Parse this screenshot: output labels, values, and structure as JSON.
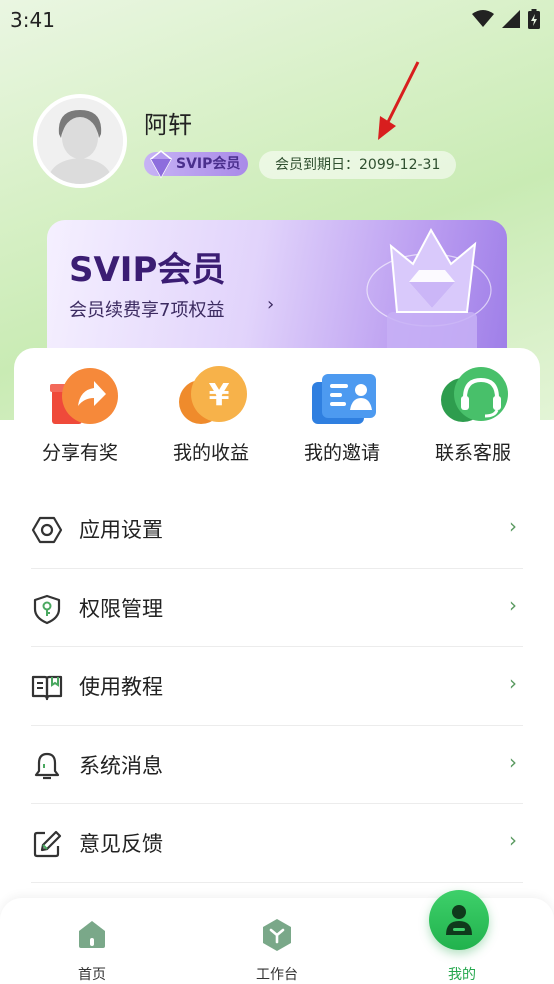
{
  "status_bar": {
    "time": "3:41",
    "icons": [
      "wifi-icon",
      "signal-icon",
      "battery-icon"
    ]
  },
  "profile": {
    "username": "阿轩",
    "badge_label": "SVIP会员",
    "expiry_label": "会员到期日：",
    "expiry_date": "2099-12-31"
  },
  "vip_card": {
    "title": "SVIP会员",
    "subtitle": "会员续费享7项权益",
    "arrow": "›"
  },
  "quick_actions": [
    {
      "label": "分享有奖",
      "icon": "gift-share-icon"
    },
    {
      "label": "我的收益",
      "icon": "yuan-coin-icon"
    },
    {
      "label": "我的邀请",
      "icon": "contact-card-icon"
    },
    {
      "label": "联系客服",
      "icon": "headset-icon"
    }
  ],
  "menu": [
    {
      "label": "应用设置",
      "icon": "hexagon-settings-icon"
    },
    {
      "label": "权限管理",
      "icon": "shield-key-icon"
    },
    {
      "label": "使用教程",
      "icon": "book-icon"
    },
    {
      "label": "系统消息",
      "icon": "bell-icon"
    },
    {
      "label": "意见反馈",
      "icon": "edit-icon"
    }
  ],
  "menu_chevron": "›",
  "bottom_nav": [
    {
      "label": "首页",
      "icon": "home-icon",
      "active": false
    },
    {
      "label": "工作台",
      "icon": "workbench-icon",
      "active": false
    },
    {
      "label": "我的",
      "icon": "person-icon",
      "active": true
    }
  ],
  "colors": {
    "accent_green": "#25a74d",
    "vip_purple": "#3b1d73",
    "chevron_green": "#5a9a60"
  }
}
